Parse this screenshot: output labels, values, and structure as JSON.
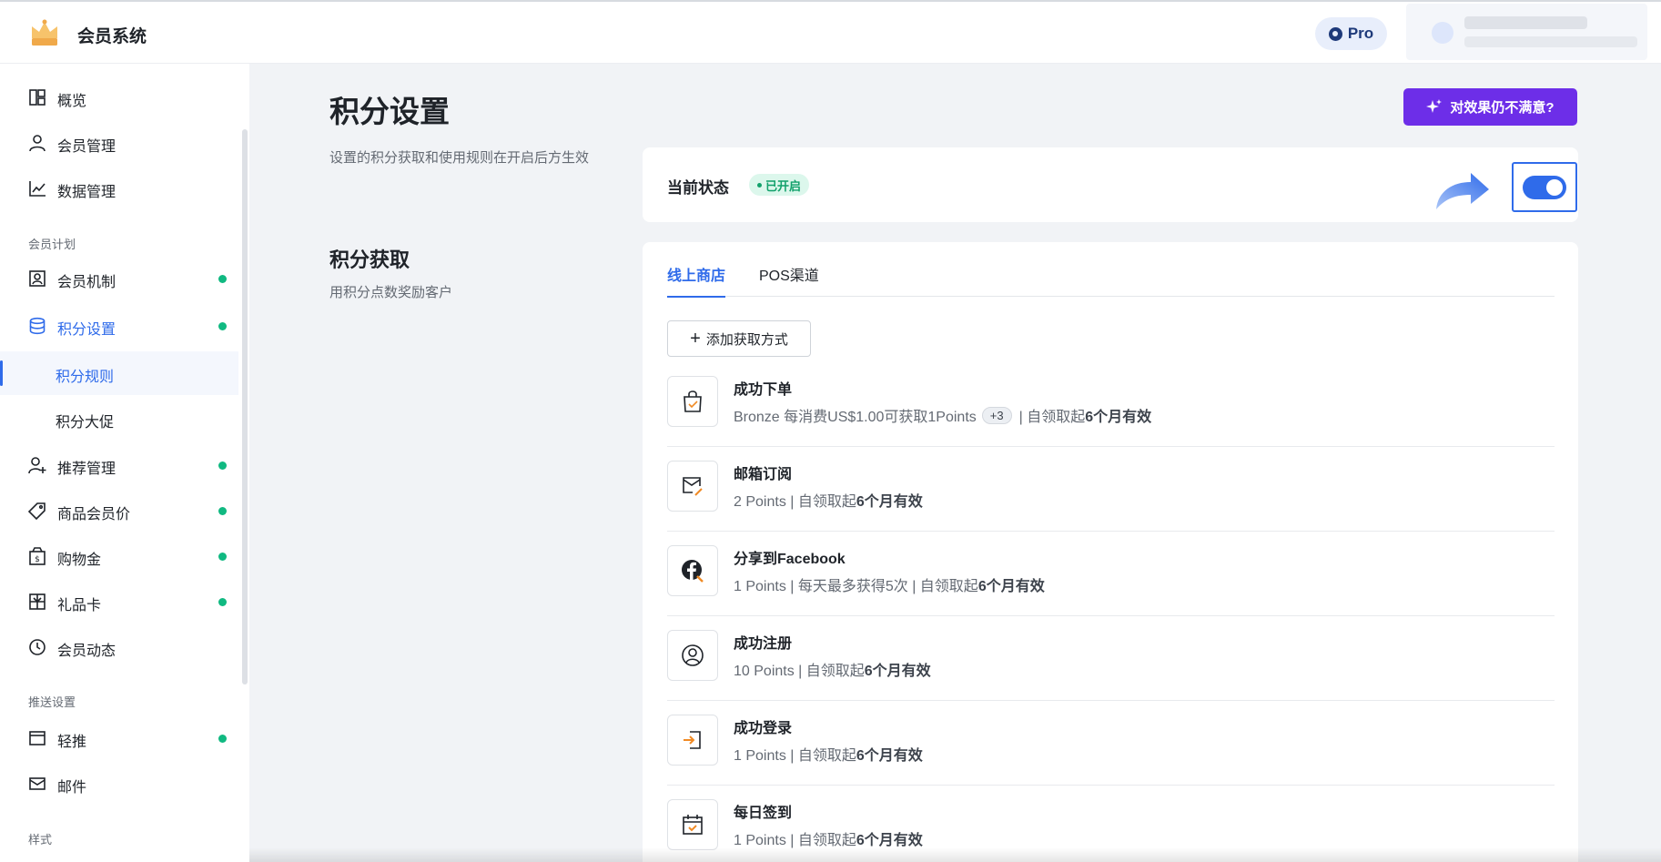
{
  "header": {
    "app_title": "会员系统",
    "plan_badge": "Pro",
    "logo_icon": "crown-icon",
    "accent_color": "#2f6bea"
  },
  "sidebar": {
    "items_top": [
      {
        "label": "概览",
        "icon": "dashboard-icon"
      },
      {
        "label": "会员管理",
        "icon": "user-icon"
      },
      {
        "label": "数据管理",
        "icon": "line-chart-icon"
      }
    ],
    "section_plan": "会员计划",
    "items_plan": [
      {
        "label": "会员机制",
        "icon": "membership-icon",
        "dot": true
      },
      {
        "label": "积分设置",
        "icon": "database-icon",
        "dot": true,
        "active": true
      }
    ],
    "sub_items": [
      {
        "label": "积分规则",
        "selected": true
      },
      {
        "label": "积分大促",
        "selected": false
      }
    ],
    "items_plan_more": [
      {
        "label": "推荐管理",
        "icon": "user-add-icon",
        "dot": true
      },
      {
        "label": "商品会员价",
        "icon": "tag-icon",
        "dot": true
      },
      {
        "label": "购物金",
        "icon": "wallet-icon",
        "dot": true
      },
      {
        "label": "礼品卡",
        "icon": "gift-card-icon",
        "dot": true
      },
      {
        "label": "会员动态",
        "icon": "clock-icon",
        "dot": false
      }
    ],
    "section_push": "推送设置",
    "items_push": [
      {
        "label": "轻推",
        "icon": "window-icon",
        "dot": true
      },
      {
        "label": "邮件",
        "icon": "mail-icon",
        "dot": false
      }
    ],
    "section_style": "样式"
  },
  "main": {
    "title": "积分设置",
    "description": "设置的积分获取和使用规则在开启后方生效",
    "cta_label": "对效果仍不满意?",
    "status": {
      "label": "当前状态",
      "badge": "已开启",
      "toggle_on": true
    },
    "earn_section": {
      "title": "积分获取",
      "description": "用积分点数奖励客户"
    },
    "tabs": [
      {
        "label": "线上商店",
        "active": true
      },
      {
        "label": "POS渠道",
        "active": false
      }
    ],
    "add_button_label": "添加获取方式",
    "rules": [
      {
        "icon": "shopping-bag-icon",
        "title": "成功下单",
        "desc_prefix": "Bronze 每消费US$1.00可获取1Points",
        "more": "+3",
        "desc_mid": "| 自领取起 ",
        "validity": "6个月有效"
      },
      {
        "icon": "mail-edit-icon",
        "title": "邮箱订阅",
        "desc_prefix": "",
        "more": "",
        "desc_mid": "2 Points | 自领取起 ",
        "validity": "6个月有效"
      },
      {
        "icon": "facebook-icon",
        "title": "分享到Facebook",
        "desc_prefix": "",
        "more": "",
        "desc_mid": "1 Points | 每天最多获得5次 | 自领取起 ",
        "validity": "6个月有效"
      },
      {
        "icon": "user-circle-icon",
        "title": "成功注册",
        "desc_prefix": "",
        "more": "",
        "desc_mid": "10 Points | 自领取起 ",
        "validity": "6个月有效"
      },
      {
        "icon": "login-icon",
        "title": "成功登录",
        "desc_prefix": "",
        "more": "",
        "desc_mid": "1 Points | 自领取起 ",
        "validity": "6个月有效"
      },
      {
        "icon": "calendar-check-icon",
        "title": "每日签到",
        "desc_prefix": "",
        "more": "",
        "desc_mid": "1 Points | 自领取起 ",
        "validity": "6个月有效"
      }
    ]
  }
}
